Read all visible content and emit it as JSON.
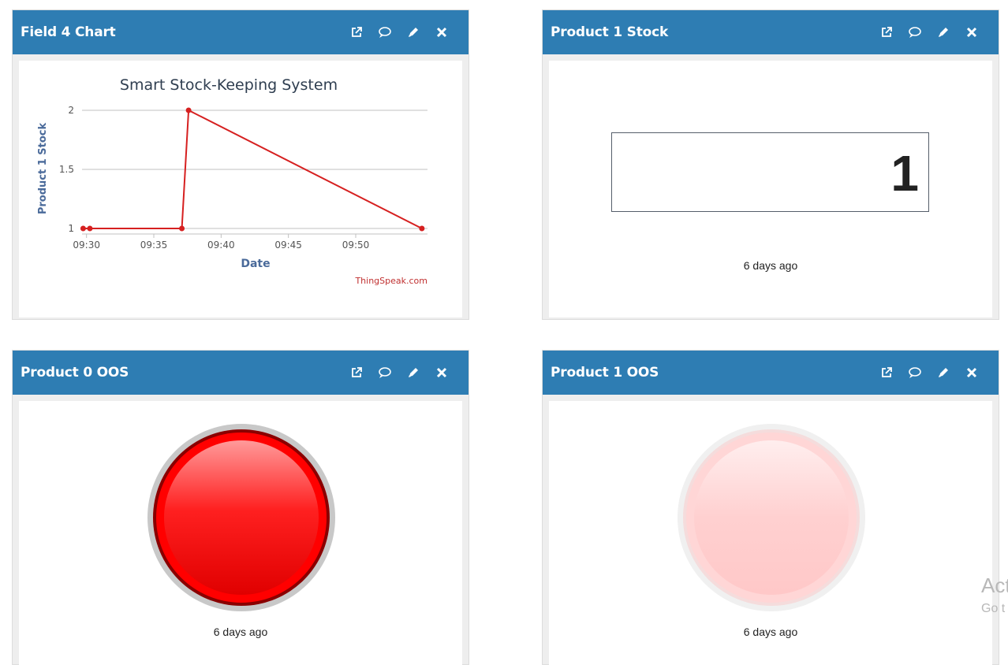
{
  "widgets": [
    {
      "title": "Field 4 Chart"
    },
    {
      "title": "Product 1 Stock",
      "value": "1",
      "updated": "6 days ago"
    },
    {
      "title": "Product 0 OOS",
      "updated": "6 days ago",
      "lamp_on": true,
      "lamp_color": "#ff0000"
    },
    {
      "title": "Product 1 OOS",
      "updated": "6 days ago",
      "lamp_on": false,
      "lamp_color": "#ffcccc"
    }
  ],
  "widget_icons": [
    "external-link-icon",
    "comment-icon",
    "pencil-icon",
    "close-icon"
  ],
  "colors": {
    "header": "#2e7db3",
    "series": "#d62020"
  },
  "chart_data": {
    "type": "line",
    "title": "Smart Stock-Keeping System",
    "xlabel": "Date",
    "ylabel": "Product 1 Stock",
    "credit": "ThingSpeak.com",
    "x_ticks": [
      "09:30",
      "09:35",
      "09:40",
      "09:45",
      "09:50"
    ],
    "y_ticks": [
      "1",
      "1.5",
      "2"
    ],
    "ylim": [
      1,
      2
    ],
    "xlim": [
      "09:29:40",
      "09:55:20"
    ],
    "grid": true,
    "series": [
      {
        "x": [
          "09:29:45",
          "09:30:15",
          "09:37:05",
          "09:37:35",
          "09:54:55"
        ],
        "values": [
          1,
          1,
          1,
          2,
          1
        ]
      }
    ]
  },
  "watermark": {
    "line1": "Act",
    "line2": "Go t"
  }
}
